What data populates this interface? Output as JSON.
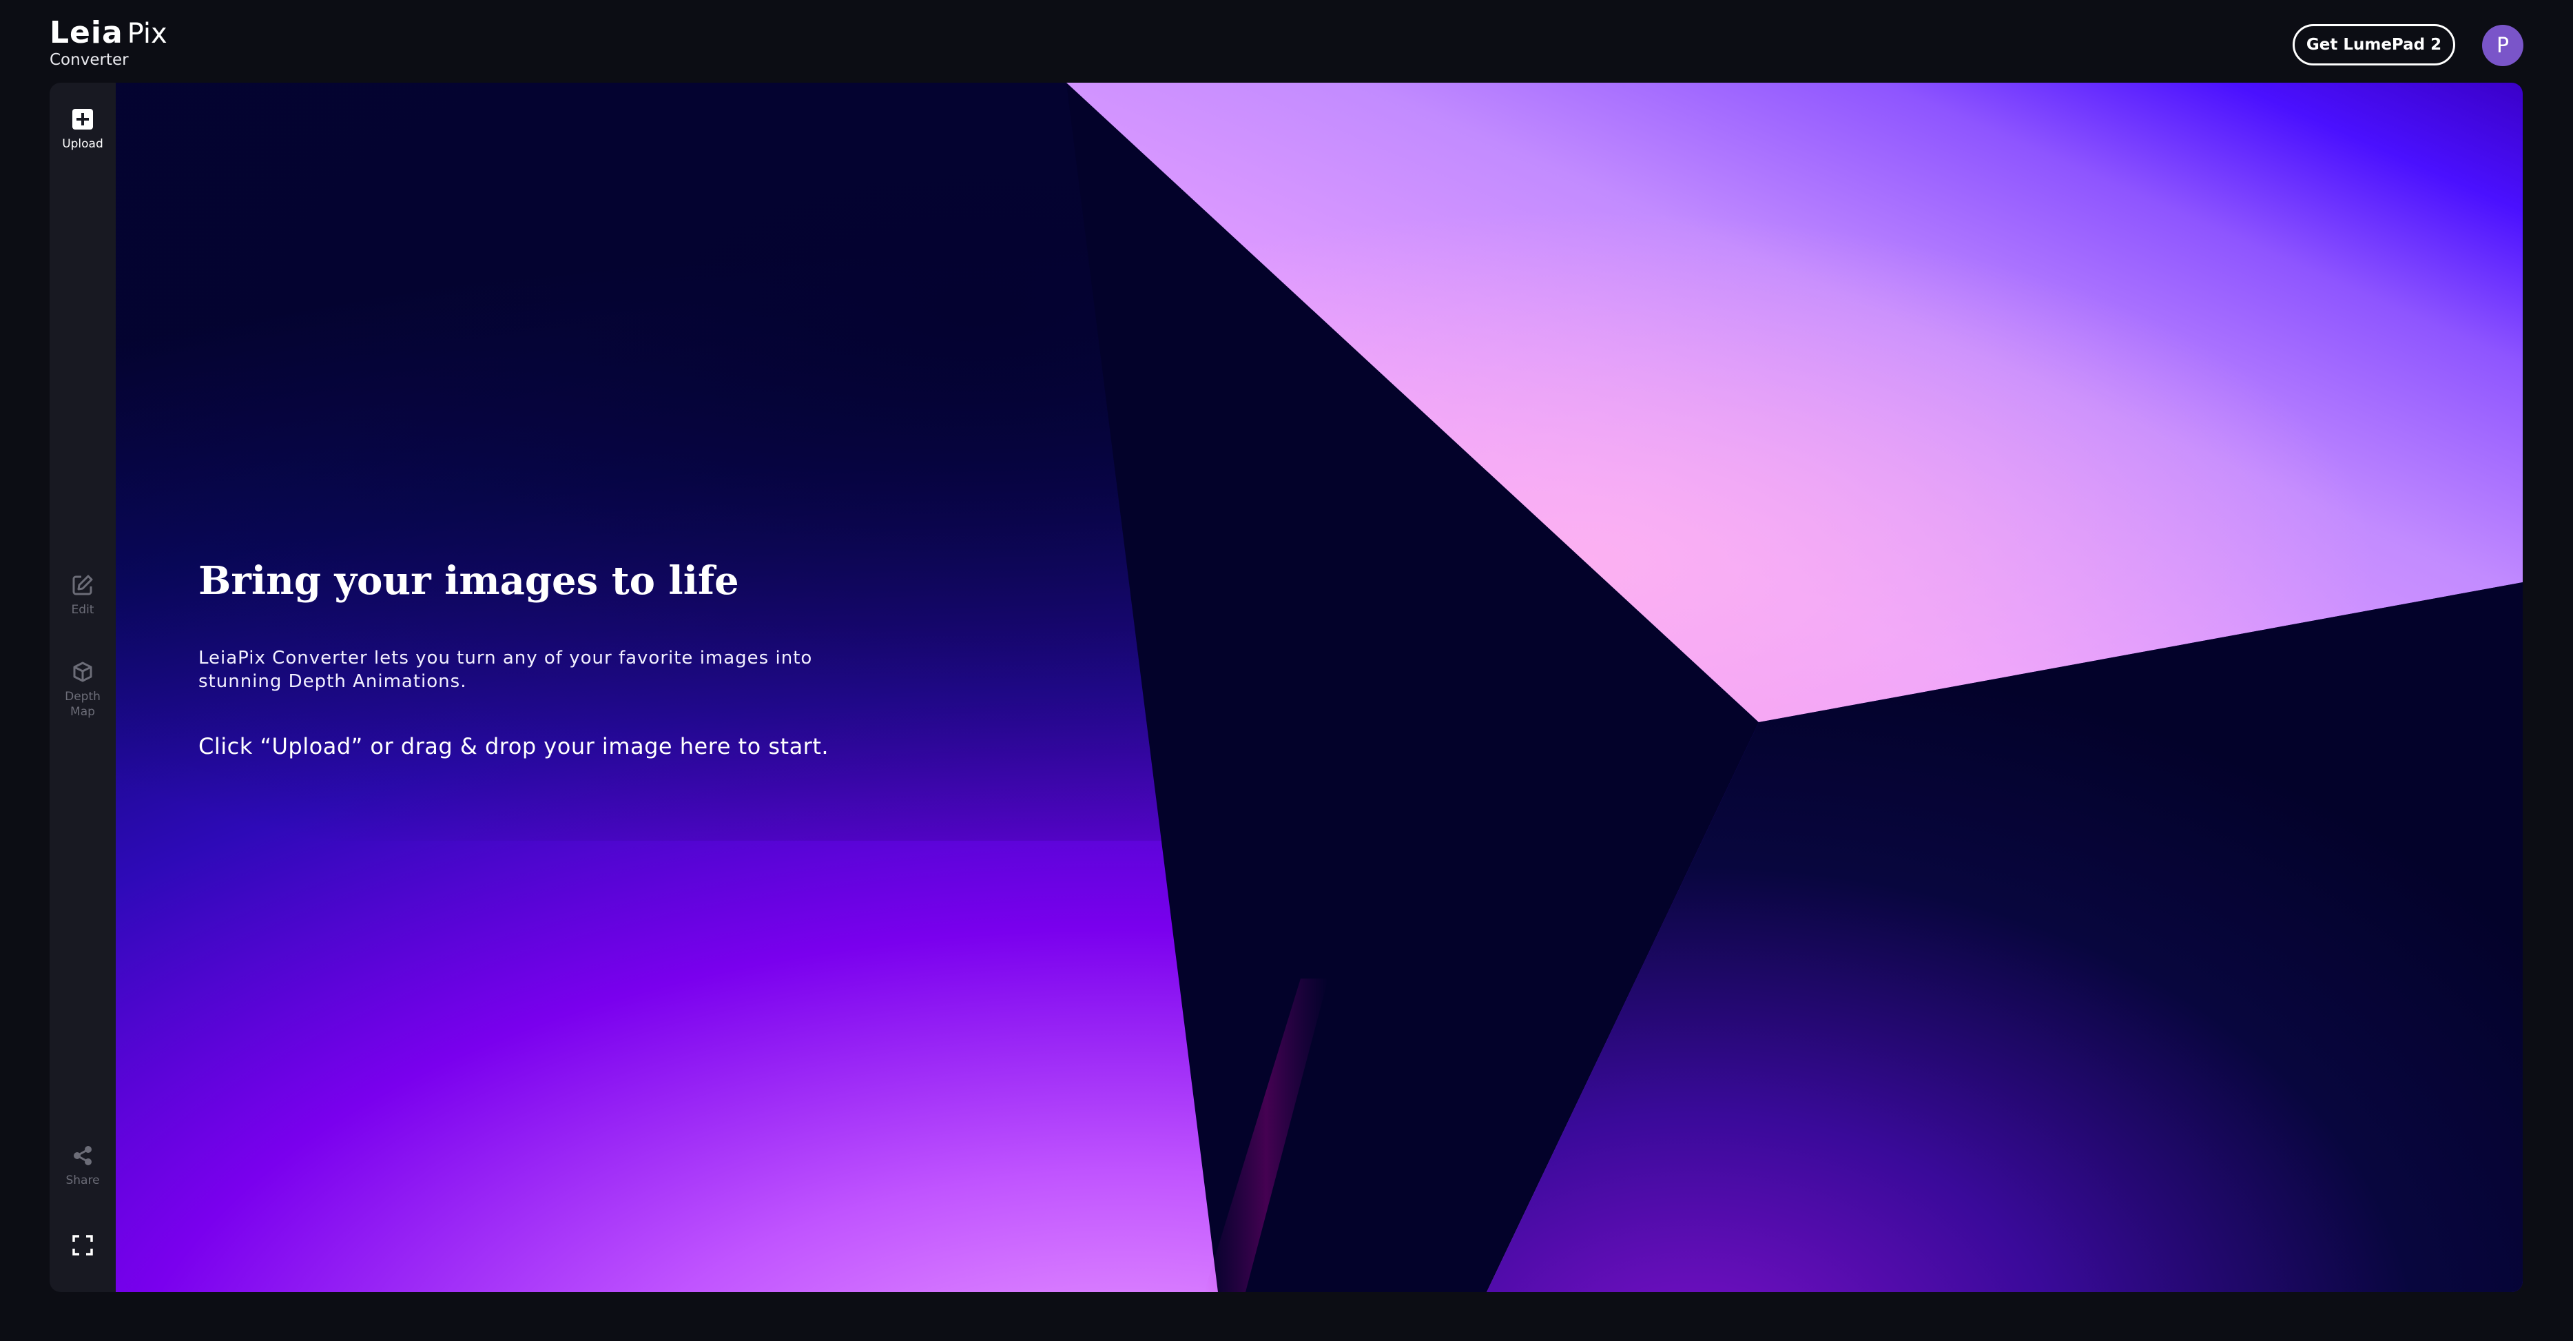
{
  "header": {
    "logo_leia": "Leia",
    "logo_pix": "Pix",
    "logo_sub": "Converter",
    "cta_label": "Get LumePad 2",
    "avatar_initial": "P"
  },
  "sidebar": {
    "items": [
      {
        "label": "Upload",
        "icon": "upload-plus-icon"
      },
      {
        "label": "Edit",
        "icon": "edit-icon"
      },
      {
        "label": "Depth\nMap",
        "icon": "depth-map-icon"
      },
      {
        "label": "Share",
        "icon": "share-icon"
      },
      {
        "label": "",
        "icon": "fullscreen-icon"
      }
    ]
  },
  "hero": {
    "title": "Bring your images to life",
    "description": "LeiaPix Converter lets you turn any of your favorite images into stunning Depth Animations.",
    "cta": "Click “Upload” or drag & drop your image here to start."
  },
  "colors": {
    "page_bg": "#0c0d14",
    "sidebar_bg": "#181922",
    "avatar": "#7a55c9",
    "accent_purple": "#7a00ff",
    "accent_pink": "#f58ff0"
  }
}
